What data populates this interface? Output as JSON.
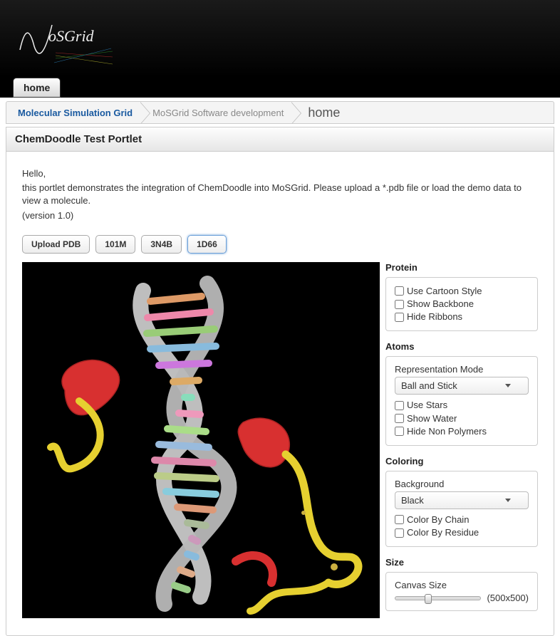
{
  "brand": "MoSGrid",
  "tabs": {
    "home": "home"
  },
  "breadcrumbs": {
    "root": "Molecular Simulation Grid",
    "section": "MoSGrid Software development",
    "page": "home"
  },
  "portlet": {
    "title": "ChemDoodle Test Portlet",
    "intro_line1": "Hello,",
    "intro_line2": "this portlet demonstrates the integration of ChemDoodle into MoSGrid. Please upload a *.pdb file or load the demo data to view a molecule.",
    "intro_line3": "(version 1.0)"
  },
  "buttons": {
    "upload": "Upload PDB",
    "d1": "101M",
    "d2": "3N4B",
    "d3": "1D66"
  },
  "panels": {
    "protein": {
      "title": "Protein",
      "use_cartoon": "Use Cartoon Style",
      "show_backbone": "Show Backbone",
      "hide_ribbons": "Hide Ribbons"
    },
    "atoms": {
      "title": "Atoms",
      "rep_label": "Representation Mode",
      "rep_value": "Ball and Stick",
      "use_stars": "Use Stars",
      "show_water": "Show Water",
      "hide_nonpoly": "Hide Non Polymers"
    },
    "coloring": {
      "title": "Coloring",
      "bg_label": "Background",
      "bg_value": "Black",
      "by_chain": "Color By Chain",
      "by_residue": "Color By Residue"
    },
    "size": {
      "title": "Size",
      "canvas_label": "Canvas Size",
      "value_text": "(500x500)"
    }
  }
}
